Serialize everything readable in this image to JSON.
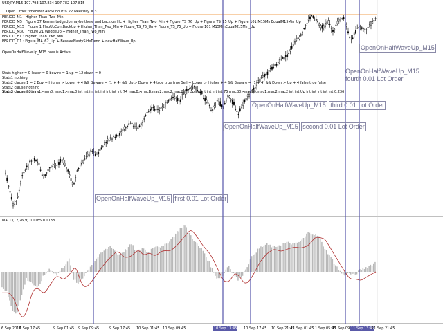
{
  "header": {
    "symbol_line": "USDJPY,M15  107.793 107.834 107.782 107.815",
    "order_info": "Open Order timeFilter Allow hour ≥ 22 weekday = 3"
  },
  "period_lines": [
    "PERIOD_M1    : Higher_Than_Two_Min",
    "PERIOD_M5    : Figure 37 RemaintedgeUp maybe there and back on HL + Higher_Than_Two_Min  +  Figure_TS_76_Up  +  Figure_TS_75_Up  +  Figure 101 M15MinEqualM15Min_Up",
    "PERIOD_M15   : Figure 1 FlagUpContBackUp  +  Higher_Than_Two_Min  +  Figure_TS_76_Up  +  Figure_TS_75_Up  +  Figure 101 M15MinEqualM15Min_Up",
    "PERIOD_M30   : Figure 21 WedgeUp  +  Higher_Than_Two_Min",
    "PERIOD_H1    : Higher_Than_Two_Min",
    "PERIOD_D1    : Figure_MA_62_Up  +  BewareNastySideTrend  +  newHalfWave_Up"
  ],
  "active_note": "OpenOnHalfWaveUp_M15 now is Active",
  "stats_lines": [
    "Stats     higher = 0 lower = 0 bewire = 1 up = 12 down = 0",
    "Stats1    nothing",
    "Stats2 clause 1 = 2   Buy = Higher > Lower + 4 && Beware = (1 + 4) && Up > Down + 4 true true true Sell = Lower > Higher + 4 && Beware = (1 + 4) && Down > Up + 4 false true false",
    "Stats2 clause nothing",
    "Stats2 clause nothing",
    "Stats3 clause 73 mm1>mm0, mac1>mac0 int int int int int int int int 74 macB>macB,mac2,mac2,mac2 int Up int int int int int 75 macB0>macB0,mac1,mac2,mac2 int int Up int int int int int 0.236"
  ],
  "orders": [
    {
      "name": "OpenOnHalfWaveUp_M15",
      "label": "first 0.01 Lot Order"
    },
    {
      "name": "OpenOnHalfWaveUp_M15",
      "label": "second 0.01 Lot Order"
    },
    {
      "name": "OpenOnHalfWaveUp_M15",
      "label": "third 0.01 Lot Order"
    },
    {
      "name": "OpenOnHalfWaveUp_M15",
      "label": "fourth 0.01 Lot Order"
    },
    {
      "name": "OpenOnHalfWaveUp_M15",
      "label": ""
    }
  ],
  "indicator_label": "MACD(12,26,9) 0.0185 0.0138",
  "time_axis": [
    {
      "text": "6 Sep 2019",
      "hl": false
    },
    {
      "text": "6 Sep 17:45",
      "hl": false
    },
    {
      "text": "9 Sep 01:45",
      "hl": false
    },
    {
      "text": "9 Sep 09:45",
      "hl": false
    },
    {
      "text": "9 Sep 17:45",
      "hl": false
    },
    {
      "text": "10 Sep 01:45",
      "hl": false
    },
    {
      "text": "10 Sep 09:45",
      "hl": false
    },
    {
      "text": "10 Sep 13:45",
      "hl": true
    },
    {
      "text": "10 Sep 17:45",
      "hl": false
    },
    {
      "text": "10 Sep 21:45",
      "hl": false
    },
    {
      "text": "11 Sep 01:45",
      "hl": false
    },
    {
      "text": "11 Sep 05:45",
      "hl": false
    },
    {
      "text": "11 Sep 09:45",
      "hl": false
    },
    {
      "text": "11 Sep 13:45",
      "hl": true
    },
    {
      "text": "11 Sep 21:45",
      "hl": false
    }
  ],
  "colors": {
    "candle": "#000000",
    "vline": "#5555aa",
    "price_line": "#f0a050",
    "macd_hist": "#b8b8b8",
    "signal": "#b03030",
    "separator": "#808080"
  },
  "chart_data": {
    "type": "candlestick",
    "symbol": "USDJPY",
    "timeframe": "M15",
    "last_bar": {
      "open": 107.793,
      "high": 107.834,
      "low": 107.782,
      "close": 107.815
    },
    "indicator": {
      "name": "MACD",
      "params": [
        12,
        26,
        9
      ],
      "values": [
        0.0185,
        0.0138
      ]
    }
  }
}
